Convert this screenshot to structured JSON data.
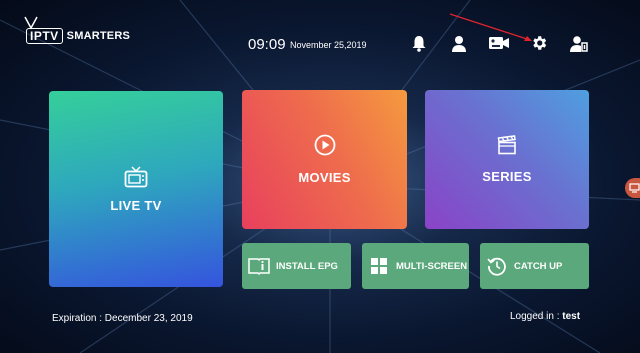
{
  "app": {
    "logo_boxed": "IPTV",
    "logo_text": "SMARTERS"
  },
  "header": {
    "time": "09:09",
    "date": "November 25,2019",
    "icons": [
      "bell-icon",
      "user-icon",
      "video-record-icon",
      "gear-icon",
      "switch-user-icon"
    ]
  },
  "tiles": {
    "live_tv": {
      "label": "LIVE TV",
      "icon": "tv-icon"
    },
    "movies": {
      "label": "MOVIES",
      "icon": "play-circle-icon"
    },
    "series": {
      "label": "SERIES",
      "icon": "clapperboard-icon"
    }
  },
  "actions": [
    {
      "label": "INSTALL EPG",
      "icon": "epg-book-icon"
    },
    {
      "label": "MULTI-SCREEN",
      "icon": "grid-icon"
    },
    {
      "label": "CATCH UP",
      "icon": "history-icon"
    }
  ],
  "footer": {
    "expiration": "Expiration : December 23, 2019",
    "logged_label": "Logged in :",
    "username": "test"
  },
  "colors": {
    "live_tv_gradient": [
      "#35cf9a",
      "#3554de"
    ],
    "movies_gradient": [
      "#e8405d",
      "#f59a3e"
    ],
    "series_gradient": [
      "#8a43c7",
      "#4f9fe0"
    ],
    "action_tile": "#5aa87b",
    "annotation_arrow": "#e0242c"
  }
}
